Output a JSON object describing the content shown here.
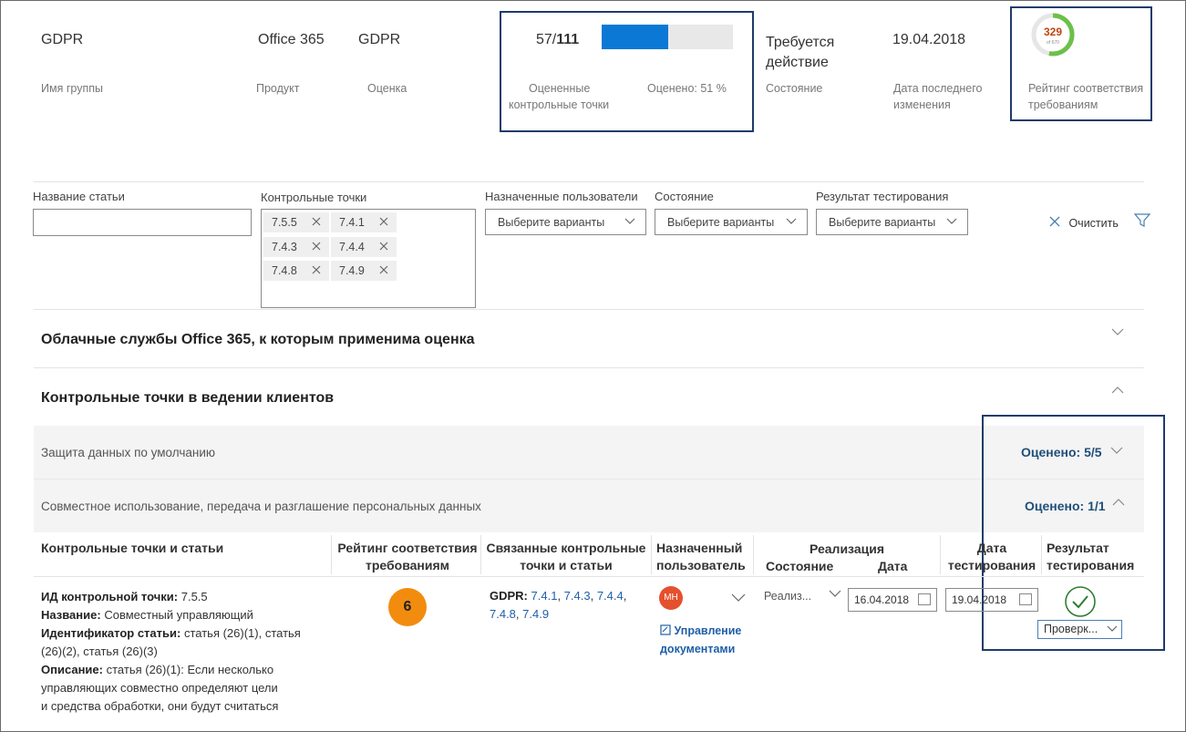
{
  "summary": {
    "group_name": "GDPR",
    "group_name_label": "Имя группы",
    "product": "Office 365",
    "product_label": "Продукт",
    "assessment": "GDPR",
    "assessment_label": "Оценка",
    "assessed_count": "57/",
    "assessed_total": "111",
    "assessed_label_line1": "Оцененные",
    "assessed_label_line2": "контрольные точки",
    "assessed_percent_label": "Оценено: 51 %",
    "assessed_fraction": 0.51,
    "status_line1": "Требуется",
    "status_line2": "действие",
    "status_label": "Состояние",
    "last_modified": "19.04.2018",
    "last_modified_label_line1": "Дата последнего",
    "last_modified_label_line2": "изменения",
    "compliance_score": "329",
    "compliance_score_sub": "of 670",
    "compliance_label_line1": "Рейтинг соответствия",
    "compliance_label_line2": "требованиям"
  },
  "filters": {
    "article_name_label": "Название статьи",
    "article_name_value": "",
    "control_points_label": "Контрольные точки",
    "control_point_tags": [
      "7.5.5",
      "7.4.1",
      "7.4.3",
      "7.4.4",
      "7.4.8",
      "7.4.9"
    ],
    "assigned_users_label": "Назначенные пользователи",
    "status_label": "Состояние",
    "test_result_label": "Результат тестирования",
    "dropdown_placeholder": "Выберите варианты",
    "clear_label": "Очистить"
  },
  "sections": {
    "cloud_services_title": "Облачные службы Office 365, к которым применима оценка",
    "customer_controls_title": "Контрольные точки в ведении клиентов",
    "group1_title": "Защита данных по умолчанию",
    "group1_scored": "Оценено: 5/5",
    "group2_title": "Совместное использование, передача и разглашение персональных данных",
    "group2_scored": "Оценено: 1/1"
  },
  "table": {
    "headers": {
      "controls": "Контрольные точки и статьи",
      "rating_line1": "Рейтинг соответствия",
      "rating_line2": "требованиям",
      "related_line1": "Связанные контрольные",
      "related_line2": "точки и статьи",
      "assigned_line1": "Назначенный",
      "assigned_line2": "пользователь",
      "implementation": "Реализация",
      "impl_status": "Состояние",
      "impl_date": "Дата",
      "test_date_line1": "Дата",
      "test_date_line2": "тестирования",
      "result_line1": "Результат",
      "result_line2": "тестирования"
    },
    "row": {
      "control_id_label": "ИД контрольной точки:",
      "control_id": "7.5.5",
      "name_label": "Название:",
      "name": "Совместный управляющий",
      "article_id_label": "Идентификатор статьи:",
      "article_id_line1": "статья (26)(1), статья",
      "article_id_line2": "(26)(2), статья (26)(3)",
      "description_label": "Описание:",
      "description_line1": "статья (26)(1): Если несколько",
      "description_line2": "управляющих совместно определяют цели",
      "description_line3": "и средства обработки, они будут считаться",
      "rating": "6",
      "related_prefix": "GDPR:",
      "related_links": [
        "7.4.1",
        "7.4.3",
        "7.4.4",
        "7.4.8",
        "7.4.9"
      ],
      "user_initials": "МН",
      "doc_link_line1": "Управление",
      "doc_link_line2": "документами",
      "impl_status": "Реализ...",
      "impl_date": "16.04.2018",
      "test_date": "19.04.2018",
      "result_value": "Проверк..."
    }
  },
  "colors": {
    "accent": "#0a78d4",
    "highlight_box": "#1f3b6b",
    "badge": "#f28c0f",
    "avatar": "#e5502d",
    "pass": "#2e7d32"
  }
}
